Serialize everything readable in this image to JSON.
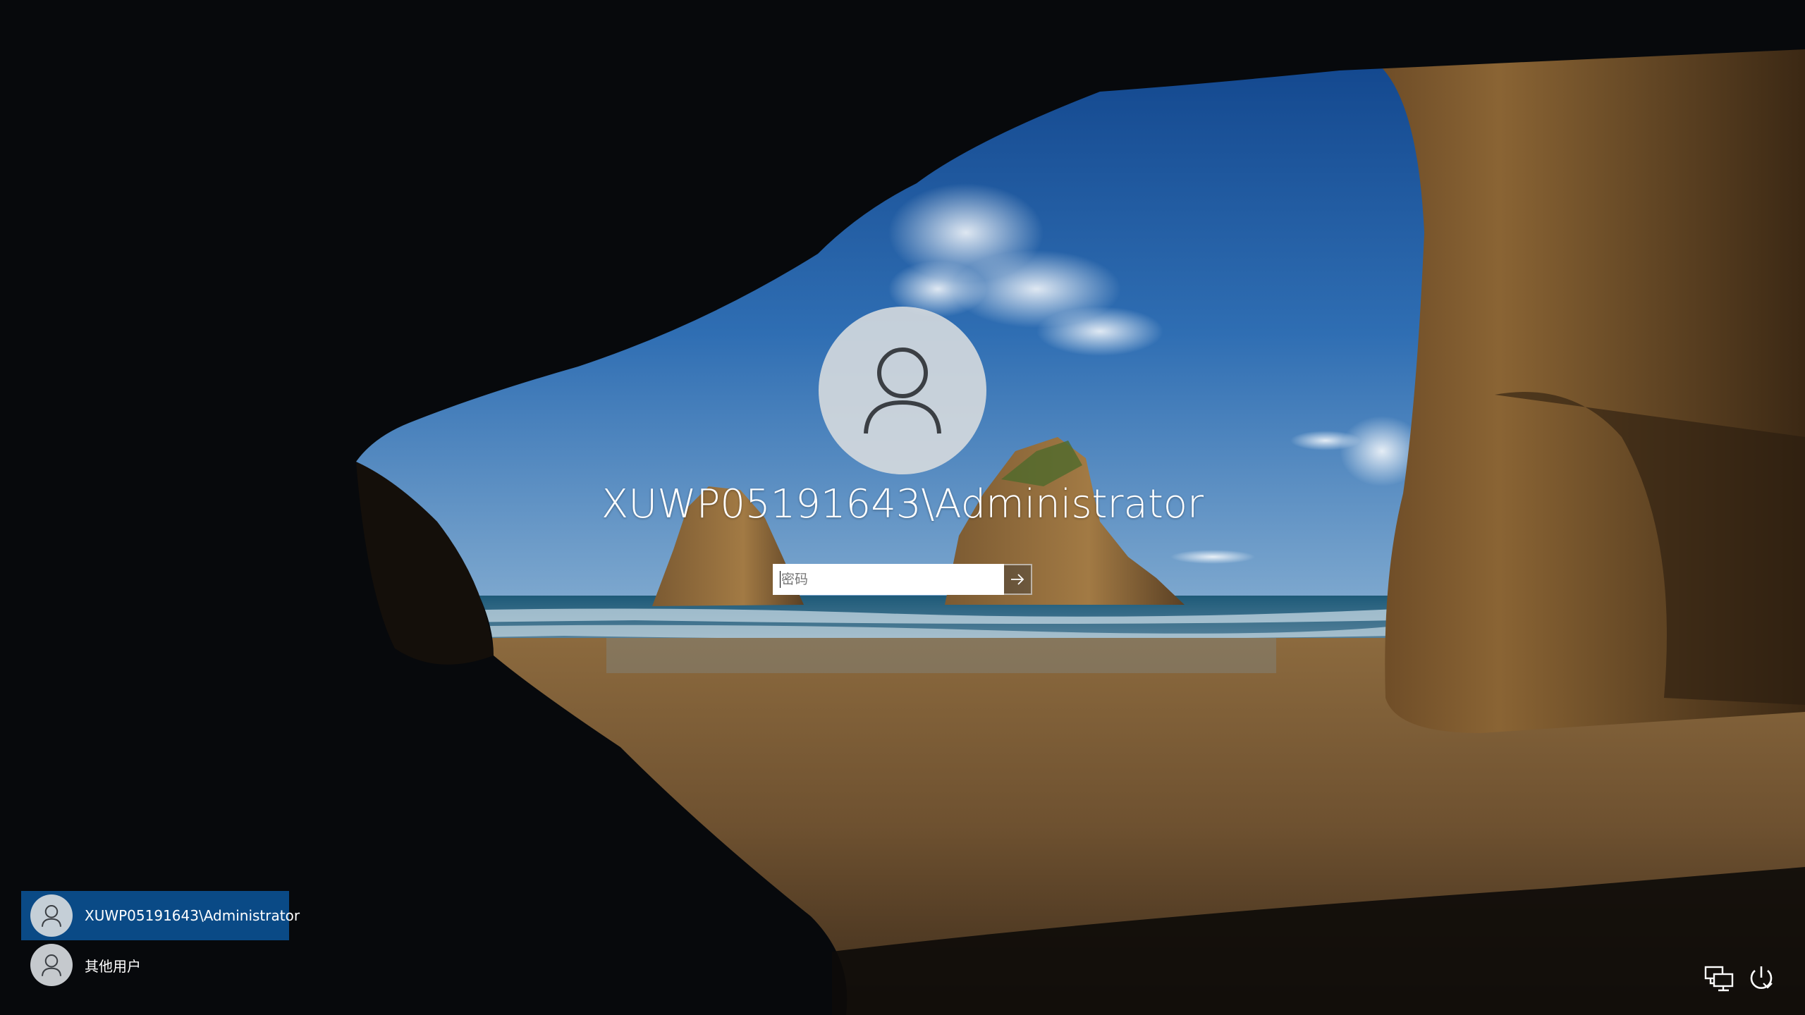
{
  "signin": {
    "user_name": "XUWP05191643\\Administrator",
    "password_placeholder": "密码",
    "password_value": ""
  },
  "user_list": {
    "items": [
      {
        "label": "XUWP05191643\\Administrator",
        "selected": true
      },
      {
        "label": "其他用户",
        "selected": false
      }
    ]
  },
  "corner_icons": {
    "network": "network-icon",
    "power": "power-icon"
  },
  "colors": {
    "selected_tile": "#0a4a86",
    "avatar_bg": "#d6dade",
    "text": "#ffffff"
  }
}
